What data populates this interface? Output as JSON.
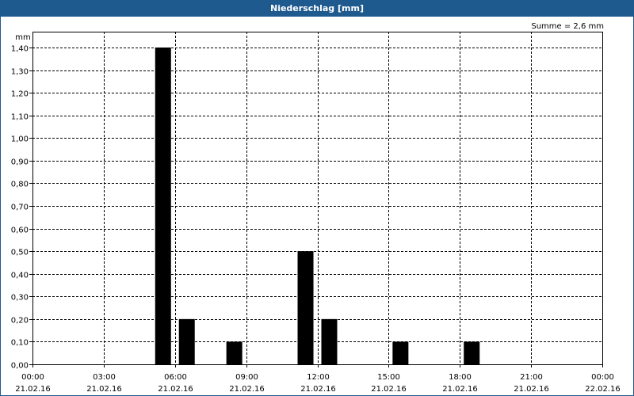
{
  "window": {
    "title": "Niederschlag [mm]"
  },
  "chart_data": {
    "type": "bar",
    "title": "Niederschlag [mm]",
    "ylabel": "mm",
    "annotation": "Summe = 2,6 mm",
    "ylim": [
      0,
      1.4
    ],
    "yticks": [
      0,
      0.1,
      0.2,
      0.3,
      0.4,
      0.5,
      0.6,
      0.7,
      0.8,
      0.9,
      1.0,
      1.1,
      1.2,
      1.3,
      1.4
    ],
    "ytick_labels": [
      "0,00",
      "0,10",
      "0,20",
      "0,30",
      "0,40",
      "0,50",
      "0,60",
      "0,70",
      "0,80",
      "0,90",
      "1,00",
      "1,10",
      "1,20",
      "1,30",
      "1,40"
    ],
    "xlim_hours": [
      0,
      24
    ],
    "xticks": [
      {
        "hour": 0,
        "time": "00:00",
        "date": "21.02.16"
      },
      {
        "hour": 3,
        "time": "03:00",
        "date": "21.02.16"
      },
      {
        "hour": 6,
        "time": "06:00",
        "date": "21.02.16"
      },
      {
        "hour": 9,
        "time": "09:00",
        "date": "21.02.16"
      },
      {
        "hour": 12,
        "time": "12:00",
        "date": "21.02.16"
      },
      {
        "hour": 15,
        "time": "15:00",
        "date": "21.02.16"
      },
      {
        "hour": 18,
        "time": "18:00",
        "date": "21.02.16"
      },
      {
        "hour": 21,
        "time": "21:00",
        "date": "21.02.16"
      },
      {
        "hour": 24,
        "time": "00:00",
        "date": "22.02.16"
      }
    ],
    "bars": [
      {
        "hour": 5,
        "value": 1.4
      },
      {
        "hour": 6,
        "value": 0.2
      },
      {
        "hour": 8,
        "value": 0.1
      },
      {
        "hour": 11,
        "value": 0.5
      },
      {
        "hour": 12,
        "value": 0.2
      },
      {
        "hour": 15,
        "value": 0.1
      },
      {
        "hour": 18,
        "value": 0.1
      }
    ],
    "bar_color": "#000000",
    "grid": true,
    "grid_style": "dashed"
  }
}
